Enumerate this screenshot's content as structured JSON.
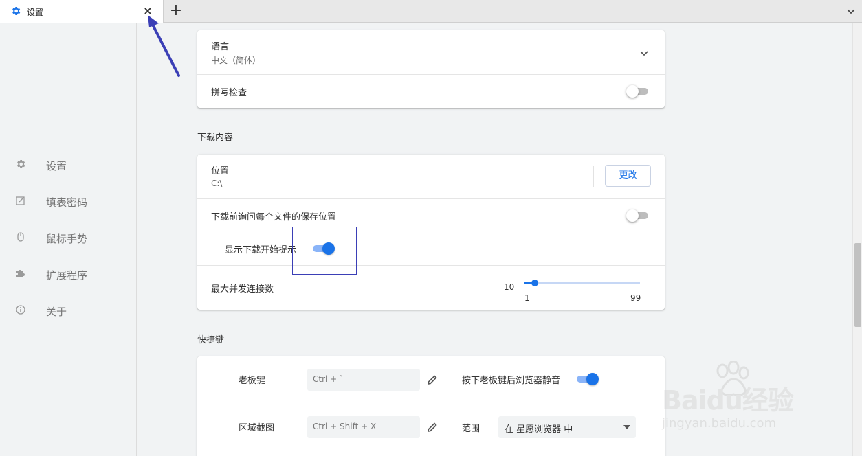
{
  "tab": {
    "title": "设置",
    "close_symbol": "×",
    "newtab_symbol": "+"
  },
  "sidebar": {
    "items": [
      {
        "label": "设置",
        "icon": "gear-icon"
      },
      {
        "label": "填表密码",
        "icon": "form-edit-icon"
      },
      {
        "label": "鼠标手势",
        "icon": "mouse-icon"
      },
      {
        "label": "扩展程序",
        "icon": "puzzle-icon"
      },
      {
        "label": "关于",
        "icon": "info-icon"
      }
    ]
  },
  "language_card": {
    "language_label": "语言",
    "language_value": "中文（简体）",
    "spellcheck_label": "拼写检查",
    "spellcheck_on": false
  },
  "downloads": {
    "section_title": "下载内容",
    "location_label": "位置",
    "location_value": "C:\\",
    "change_button": "更改",
    "ask_label": "下载前询问每个文件的保存位置",
    "ask_on": false,
    "show_prompt_label": "显示下载开始提示",
    "show_prompt_on": true,
    "max_conn_label": "最大并发连接数",
    "max_conn_value": "10",
    "slider_min": "1",
    "slider_max": "99",
    "slider_fraction": 0.09
  },
  "shortcuts": {
    "section_title": "快捷键",
    "boss_key_label": "老板键",
    "boss_key_value": "Ctrl + `",
    "mute_label": "按下老板键后浏览器静音",
    "mute_on": true,
    "screenshot_label": "区域截图",
    "screenshot_value": "Ctrl + Shift + X",
    "scope_label": "范围",
    "scope_value": "在 星愿浏览器 中"
  },
  "watermark": {
    "brand": "Baidu经验",
    "url": "jingyan.baidu.com"
  },
  "colors": {
    "accent": "#1a73e8",
    "annotation": "#3b3fb6"
  }
}
